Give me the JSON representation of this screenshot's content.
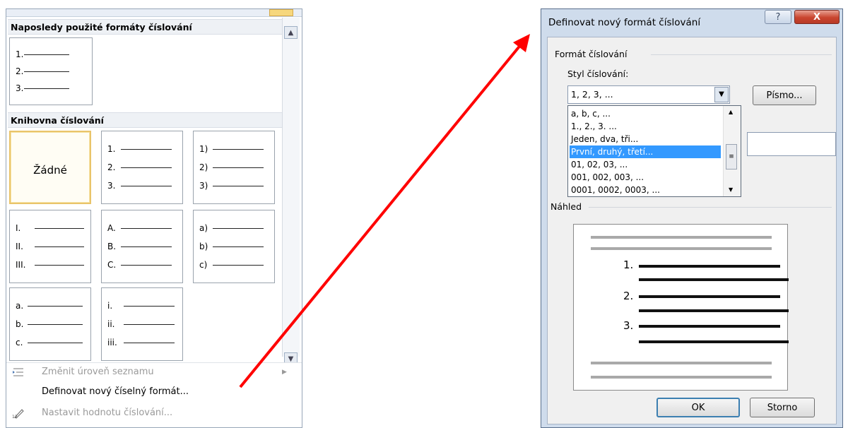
{
  "menu": {
    "recent_header": "Naposledy použité formáty číslování",
    "library_header": "Knihovna číslování",
    "recent_tiles": [
      {
        "labels": [
          "1.",
          "2.",
          "3."
        ]
      }
    ],
    "library_tiles": [
      {
        "none_label": "Žádné",
        "selected": true
      },
      {
        "labels": [
          "1.",
          "2.",
          "3."
        ]
      },
      {
        "labels": [
          "1)",
          "2)",
          "3)"
        ]
      },
      {
        "labels": [
          "I.",
          "II.",
          "III."
        ]
      },
      {
        "labels": [
          "A.",
          "B.",
          "C."
        ]
      },
      {
        "labels": [
          "a)",
          "b)",
          "c)"
        ]
      },
      {
        "labels": [
          "a.",
          "b.",
          "c."
        ]
      },
      {
        "labels": [
          "i.",
          "ii.",
          "iii."
        ]
      }
    ],
    "footer_items": {
      "change_level": {
        "label": "Změnit úroveň seznamu",
        "disabled": true,
        "icon": "indent-list-icon"
      },
      "define_new": {
        "label": "Definovat nový číselný formát...",
        "disabled": false
      },
      "set_value": {
        "label": "Nastavit hodnotu číslování...",
        "disabled": true,
        "icon": "set-numbering-value-icon"
      }
    }
  },
  "arrow": {
    "color": "#ff0000"
  },
  "dialog": {
    "title": "Definovat nový formát číslování",
    "help_symbol": "?",
    "close_symbol": "X",
    "group_format": "Formát číslování",
    "style_label": "Styl číslování:",
    "style_value": "1, 2, 3, ...",
    "font_button": "Písmo...",
    "dropdown_options": [
      "a, b, c, ...",
      "1., 2., 3. ...",
      "Jeden, dva, tři...",
      "První, druhý, třetí...",
      "01, 02, 03, ...",
      "001, 002, 003, ...",
      "0001, 0002, 0003, ..."
    ],
    "dropdown_selected_index": 3,
    "preview_label": "Náhled",
    "preview_numbers": [
      "1.",
      "2.",
      "3."
    ],
    "ok_button": "OK",
    "cancel_button": "Storno",
    "colors": {
      "frame": "#cfdcec",
      "selection": "#3399ff",
      "close": "#c9452f"
    }
  }
}
